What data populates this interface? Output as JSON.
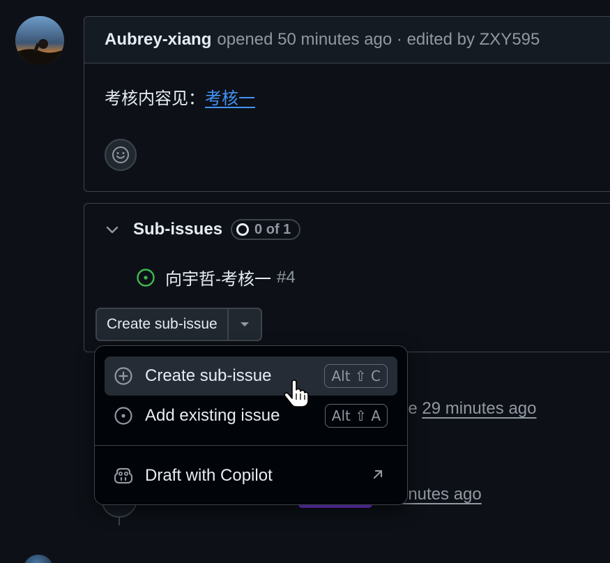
{
  "comment": {
    "author": "Aubrey-xiang",
    "meta": "opened 50 minutes ago · edited by ZXY595",
    "body_text": "考核内容见：",
    "body_link": "考核一"
  },
  "subissues": {
    "title": "Sub-issues",
    "progress": "0 of 1",
    "items": [
      {
        "title": "向宇哲-考核一",
        "number": "#4"
      }
    ],
    "create_button": "Create sub-issue"
  },
  "timeline": {
    "event1_tail": "sue",
    "event1_time": "29 minutes ago",
    "event2_time": "minutes ago"
  },
  "menu": {
    "items": [
      {
        "label": "Create sub-issue",
        "shortcut": "Alt ⇧ C",
        "icon": "plus-circle-icon"
      },
      {
        "label": "Add existing issue",
        "shortcut": "Alt ⇧ A",
        "icon": "issue-open-icon"
      },
      {
        "label": "Draft with Copilot",
        "icon": "copilot-icon"
      }
    ]
  },
  "colors": {
    "background": "#0d1117",
    "border": "#3d444d",
    "link": "#4493f8",
    "open_issue": "#3fb950",
    "muted_text": "#9198a1"
  }
}
